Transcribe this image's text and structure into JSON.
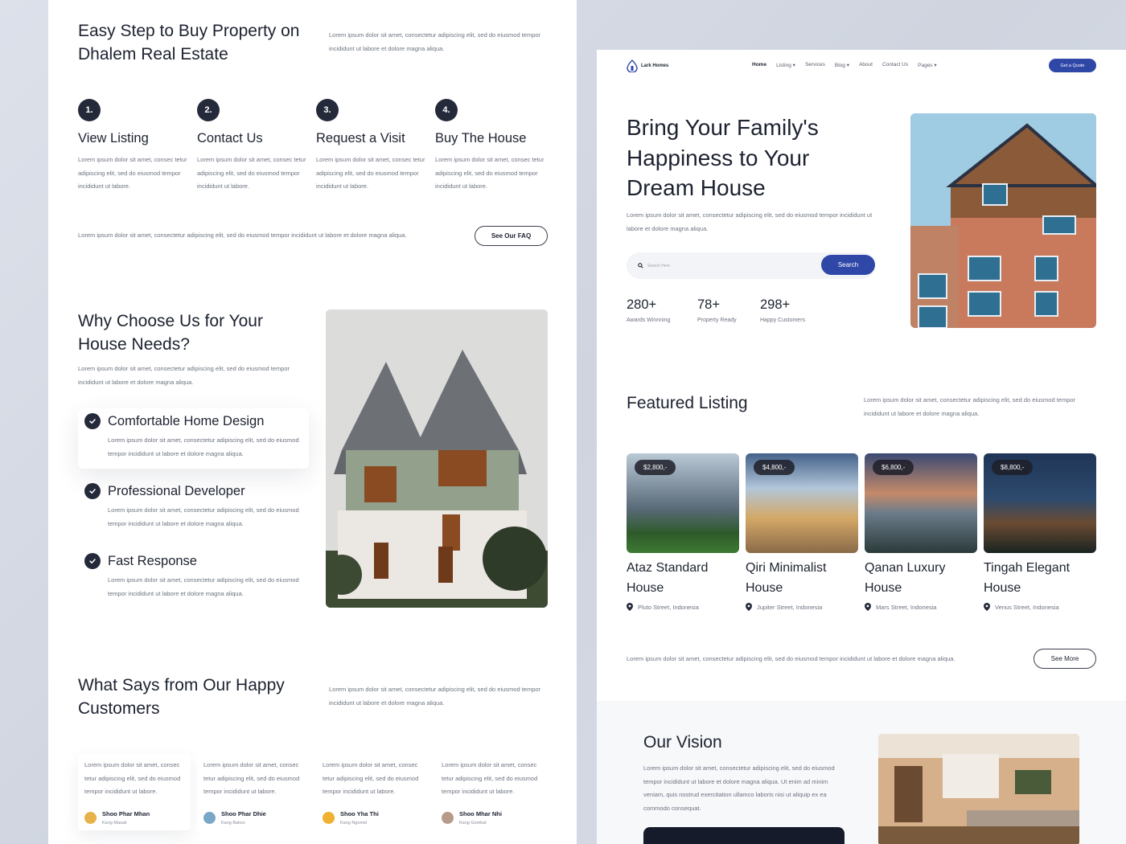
{
  "left": {
    "steps": {
      "title": "Easy Step to Buy Property on Dhalem Real Estate",
      "description": "Lorem ipsum dolor sit amet, consectetur adipiscing elit, sed do eiusmod tempor incididunt ut labore et dolore magna aliqua.",
      "items": [
        {
          "num": "1.",
          "title": "View Listing",
          "desc": "Lorem ipsum dolor sit amet, consec tetur adipiscing elit, sed do eiusmod tempor incididunt ut labore."
        },
        {
          "num": "2.",
          "title": "Contact Us",
          "desc": "Lorem ipsum dolor sit amet, consec tetur adipiscing elit, sed do eiusmod tempor incididunt ut labore."
        },
        {
          "num": "3.",
          "title": "Request a Visit",
          "desc": "Lorem ipsum dolor sit amet, consec tetur adipiscing elit, sed do eiusmod tempor incididunt ut labore."
        },
        {
          "num": "4.",
          "title": "Buy The House",
          "desc": "Lorem ipsum dolor sit amet, consec tetur adipiscing elit, sed do eiusmod tempor incididunt ut labore."
        }
      ],
      "faq_text": "Lorem ipsum dolor sit amet, consectetur adipiscing elit, sed do eiusmod tempor incididunt ut labore et dolore magna aliqua.",
      "faq_button": "See Our FAQ"
    },
    "why": {
      "title": "Why Choose Us for Your House Needs?",
      "description": "Lorem ipsum dolor sit amet, consectetur adipiscing elit, sed do eiusmod tempor incididunt ut labore et dolore magna aliqua.",
      "features": [
        {
          "title": "Comfortable Home Design",
          "desc": "Lorem ipsum dolor sit amet, consectetur adipiscing elit, sed do eiusmod tempor incididunt ut labore et dolore magna aliqua."
        },
        {
          "title": "Professional Developer",
          "desc": "Lorem ipsum dolor sit amet, consectetur adipiscing elit, sed do eiusmod tempor incididunt ut labore et dolore magna aliqua."
        },
        {
          "title": "Fast Response",
          "desc": "Lorem ipsum dolor sit amet, consectetur adipiscing elit, sed do eiusmod tempor incididunt ut labore et dolore magna aliqua."
        }
      ]
    },
    "testimonials": {
      "title": "What Says from Our Happy Customers",
      "description": "Lorem ipsum dolor sit amet, consectetur adipiscing elit, sed do eiusmod tempor incididunt ut labore et dolore magna aliqua.",
      "items": [
        {
          "text": "Lorem ipsum dolor sit amet, consec tetur adipiscing elit, sed do eiusmod tempor incididunt ut labore.",
          "name": "Shoo Phar Mhan",
          "role": "Kang Masak",
          "avatar_color": "#e8b24a"
        },
        {
          "text": "Lorem ipsum dolor sit amet, consec tetur adipiscing elit, sed do eiusmod tempor incididunt ut labore.",
          "name": "Shoo Phar Dhie",
          "role": "Kang Bakso",
          "avatar_color": "#7aa7c7"
        },
        {
          "text": "Lorem ipsum dolor sit amet, consec tetur adipiscing elit, sed do eiusmod tempor incididunt ut labore.",
          "name": "Shoo Yha Thi",
          "role": "Kang Ngomel",
          "avatar_color": "#f0b030"
        },
        {
          "text": "Lorem ipsum dolor sit amet, consec tetur adipiscing elit, sed do eiusmod tempor incididunt ut labore.",
          "name": "Shoo Mhar Nhi",
          "role": "Kang Gombal",
          "avatar_color": "#b89a8a"
        }
      ]
    }
  },
  "right": {
    "nav": {
      "logo": "Lark Homes",
      "links": [
        "Home",
        "Listing",
        "Services",
        "Blog",
        "About",
        "Contact Us",
        "Pages"
      ],
      "cta": "Get a Quote"
    },
    "hero": {
      "title": "Bring Your Family's Happiness to Your Dream House",
      "description": "Lorem ipsum dolor sit amet, consectetur adipiscing elit, sed do eiusmod tempor incididunt ut labore et dolore magna aliqua.",
      "search_placeholder": "Search Here",
      "search_button": "Search",
      "stats": [
        {
          "value": "280+",
          "label": "Awards Winnning"
        },
        {
          "value": "78+",
          "label": "Property Ready"
        },
        {
          "value": "298+",
          "label": "Happy Customers"
        }
      ]
    },
    "featured": {
      "title": "Featured Listing",
      "description": "Lorem ipsum dolor sit amet, consectetur adipiscing elit, sed do eiusmod tempor incididunt ut labore et dolore magna aliqua.",
      "listings": [
        {
          "price": "$2,800,-",
          "title": "Ataz Standard House",
          "location": "Pluto Street, Indonesia"
        },
        {
          "price": "$4,800,-",
          "title": "Qiri Minimalist House",
          "location": "Jupiter Street, Indonesia"
        },
        {
          "price": "$6,800,-",
          "title": "Qanan Luxury House",
          "location": "Mars Street, Indonesia"
        },
        {
          "price": "$8,800,-",
          "title": "Tingah Elegant House",
          "location": "Venus Street, Indonesia"
        }
      ],
      "more_text": "Lorem ipsum dolor sit amet, consectetur adipiscing elit, sed do eiusmod tempor incididunt ut labore et dolore magna aliqua.",
      "more_button": "See More"
    },
    "vision": {
      "title": "Our Vision",
      "description": "Lorem ipsum dolor sit amet, consectetur adipiscing elit, sed do eiusmod tempor incididunt ut labore et dolore magna aliqua. Ut enim ad minim veniam, quis nostrud exercitation ullamco laboris nisi ut aliquip ex ea commodo consequat."
    }
  },
  "colors": {
    "accent": "#2f48a8",
    "dark": "#252a3b",
    "background": "#d7dce6"
  }
}
